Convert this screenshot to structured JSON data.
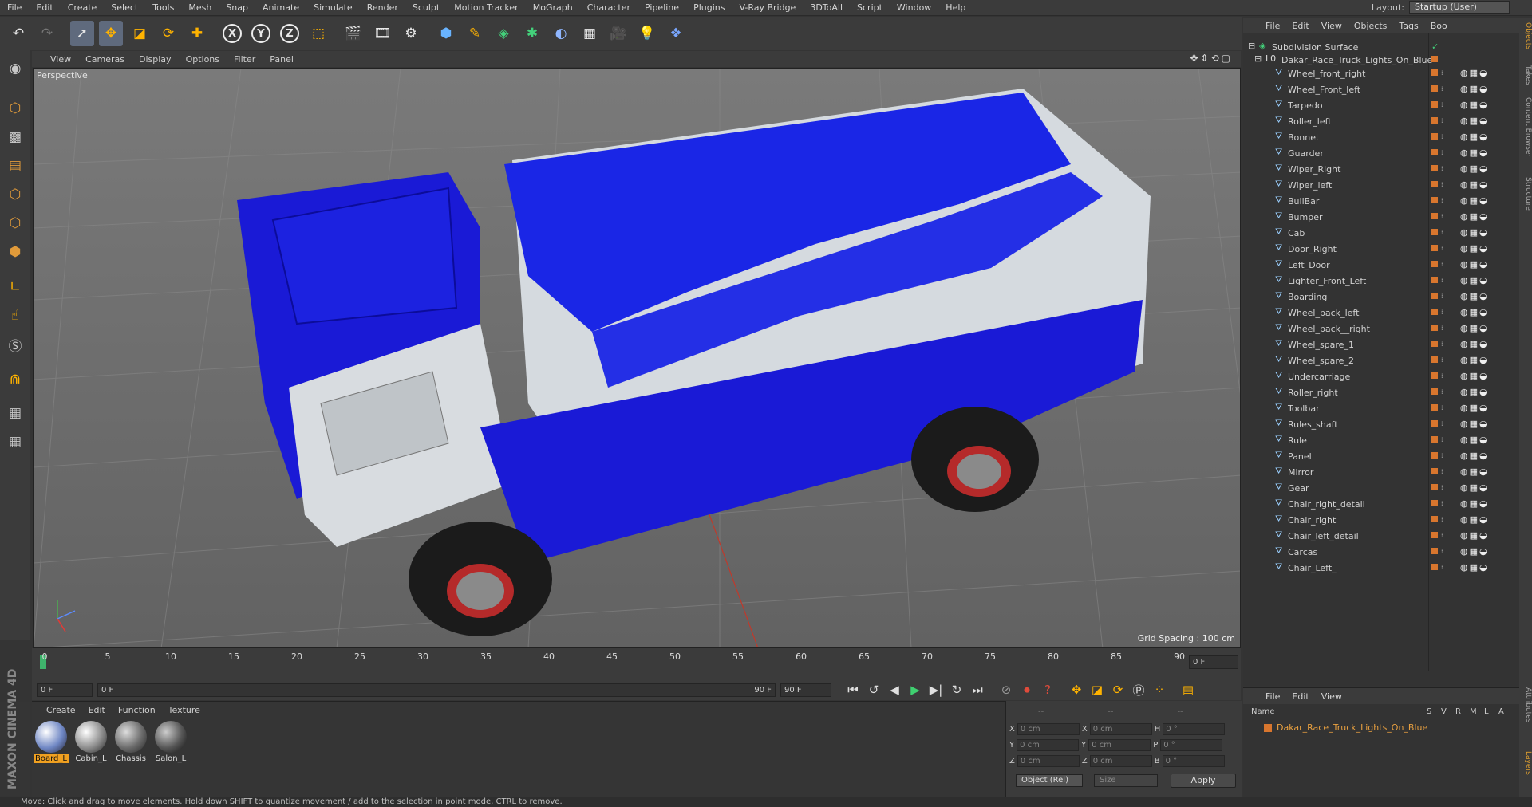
{
  "menu": [
    "File",
    "Edit",
    "Create",
    "Select",
    "Tools",
    "Mesh",
    "Snap",
    "Animate",
    "Simulate",
    "Render",
    "Sculpt",
    "Motion Tracker",
    "MoGraph",
    "Character",
    "Pipeline",
    "Plugins",
    "V-Ray Bridge",
    "3DToAll",
    "Script",
    "Window",
    "Help"
  ],
  "layout": {
    "label": "Layout:",
    "value": "Startup (User)"
  },
  "toolbar": {
    "axis_x": "X",
    "axis_y": "Y",
    "axis_z": "Z"
  },
  "viewport": {
    "menu": [
      "View",
      "Cameras",
      "Display",
      "Options",
      "Filter",
      "Panel"
    ],
    "title": "Perspective",
    "grid_spacing": "Grid Spacing : 100 cm"
  },
  "timeline": {
    "ticks": [
      "0",
      "5",
      "10",
      "15",
      "20",
      "25",
      "30",
      "35",
      "40",
      "45",
      "50",
      "55",
      "60",
      "65",
      "70",
      "75",
      "80",
      "85",
      "90"
    ],
    "current_frame": "0 F",
    "start": "0 F",
    "range_start": "0 F",
    "range_end": "90 F",
    "end": "90 F",
    "frame_display": "0 F"
  },
  "materials": {
    "menu": [
      "Create",
      "Edit",
      "Function",
      "Texture"
    ],
    "items": [
      {
        "name": "Board_L",
        "color": "#6f87c4"
      },
      {
        "name": "Cabin_L",
        "color": "#8c8c8c"
      },
      {
        "name": "Chassis",
        "color": "#6a6a6a"
      },
      {
        "name": "Salon_L",
        "color": "#555"
      }
    ]
  },
  "coords": {
    "rows": [
      {
        "a": "X",
        "av": "0 cm",
        "b": "X",
        "bv": "0 cm",
        "c": "H",
        "cv": "0 °"
      },
      {
        "a": "Y",
        "av": "0 cm",
        "b": "Y",
        "bv": "0 cm",
        "c": "P",
        "cv": "0 °"
      },
      {
        "a": "Z",
        "av": "0 cm",
        "b": "Z",
        "bv": "0 cm",
        "c": "B",
        "cv": "0 °"
      }
    ],
    "mode": "Object (Rel)",
    "size": "Size",
    "apply": "Apply",
    "headers": [
      "--",
      "--",
      "--"
    ]
  },
  "objects": {
    "menu": [
      "File",
      "Edit",
      "View",
      "Objects",
      "Tags",
      "Boo"
    ],
    "root": "Subdivision Surface",
    "group": "Dakar_Race_Truck_Lights_On_Blue",
    "children": [
      "Wheel_front_right",
      "Wheel_Front_left",
      "Tarpedo",
      "Roller_left",
      "Bonnet",
      "Guarder",
      "Wiper_Right",
      "Wiper_left",
      "BullBar",
      "Bumper",
      "Cab",
      "Door_Right",
      "Left_Door",
      "Lighter_Front_Left",
      "Boarding",
      "Wheel_back_left",
      "Wheel_back__right",
      "Wheel_spare_1",
      "Wheel_spare_2",
      "Undercarriage",
      "Roller_right",
      "Toolbar",
      "Rules_shaft",
      "Rule",
      "Panel",
      "Mirror",
      "Gear",
      "Chair_right_detail",
      "Chair_right",
      "Chair_left_detail",
      "Carcas",
      "Chair_Left_"
    ]
  },
  "side_tabs": [
    "Objects",
    "Takes",
    "Content Browser",
    "Structure",
    "Attributes",
    "Layers"
  ],
  "layers": {
    "menu": [
      "File",
      "Edit",
      "View"
    ],
    "headers": [
      "Name",
      "S",
      "V",
      "R",
      "M",
      "L",
      "A"
    ],
    "row": "Dakar_Race_Truck_Lights_On_Blue"
  },
  "brand": "MAXON CINEMA 4D",
  "status": "Move: Click and drag to move elements. Hold down SHIFT to quantize movement / add to the selection in point mode, CTRL to remove."
}
